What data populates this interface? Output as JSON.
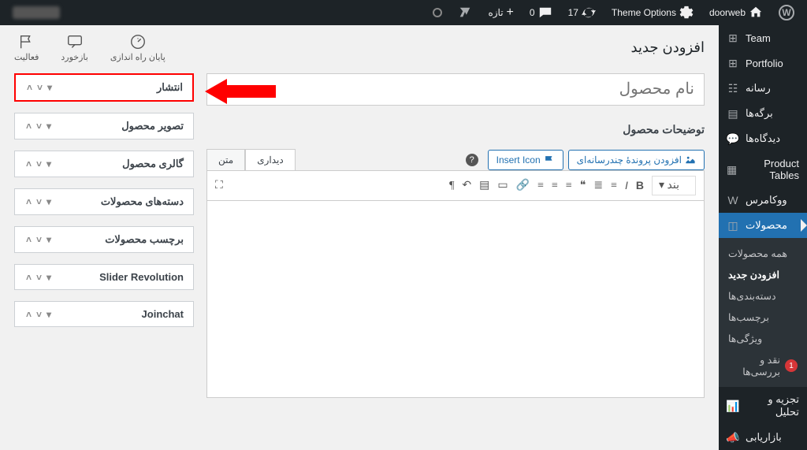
{
  "adminbar": {
    "site": "doorweb",
    "theme_options": "Theme Options",
    "comments_count": "17",
    "yoast": "",
    "new_label": "تازه",
    "updates_count": "0"
  },
  "sidebar": {
    "items": [
      {
        "label": "Team",
        "icon": "⊞"
      },
      {
        "label": "Portfolio",
        "icon": "⊞"
      },
      {
        "label": "رسانه",
        "icon": "☷"
      },
      {
        "label": "برگه‌ها",
        "icon": "▤"
      },
      {
        "label": "دیدگاه‌ها",
        "icon": "💬"
      },
      {
        "label": "Product Tables",
        "icon": "▦"
      },
      {
        "label": "ووکامرس",
        "icon": "W"
      }
    ],
    "active": {
      "label": "محصولات",
      "icon": "◫",
      "submenu": [
        {
          "label": "همه محصولات"
        },
        {
          "label": "افزودن جدید",
          "current": true
        },
        {
          "label": "دسته‌بندی‌ها"
        },
        {
          "label": "برچسب‌ها"
        },
        {
          "label": "ویژگی‌ها"
        },
        {
          "label": "نقد و بررسی‌ها",
          "badge": "1"
        }
      ]
    },
    "tail": [
      {
        "label": "تجزیه و تحلیل",
        "icon": "📊"
      },
      {
        "label": "بازاریابی",
        "icon": "📣"
      }
    ]
  },
  "page": {
    "heading": "افزودن جدید",
    "topactions": {
      "finish": "پایان راه اندازی",
      "feedback": "بازخورد",
      "activity": "فعالیت"
    },
    "title_placeholder": "نام محصول",
    "editor": {
      "title": "توضیحات محصول",
      "add_media": "افزودن پروندهٔ چندرسانه‌ای",
      "insert_icon": "Insert Icon",
      "tab_visual": "دیداری",
      "tab_text": "متن",
      "paragraph": "بند"
    },
    "sideboxes": [
      {
        "title": "انتشار",
        "highlight": true
      },
      {
        "title": "تصویر محصول"
      },
      {
        "title": "گالری محصول"
      },
      {
        "title": "دسته‌های محصولات"
      },
      {
        "title": "برچسب محصولات"
      },
      {
        "title": "Slider Revolution"
      },
      {
        "title": "Joinchat"
      }
    ]
  }
}
